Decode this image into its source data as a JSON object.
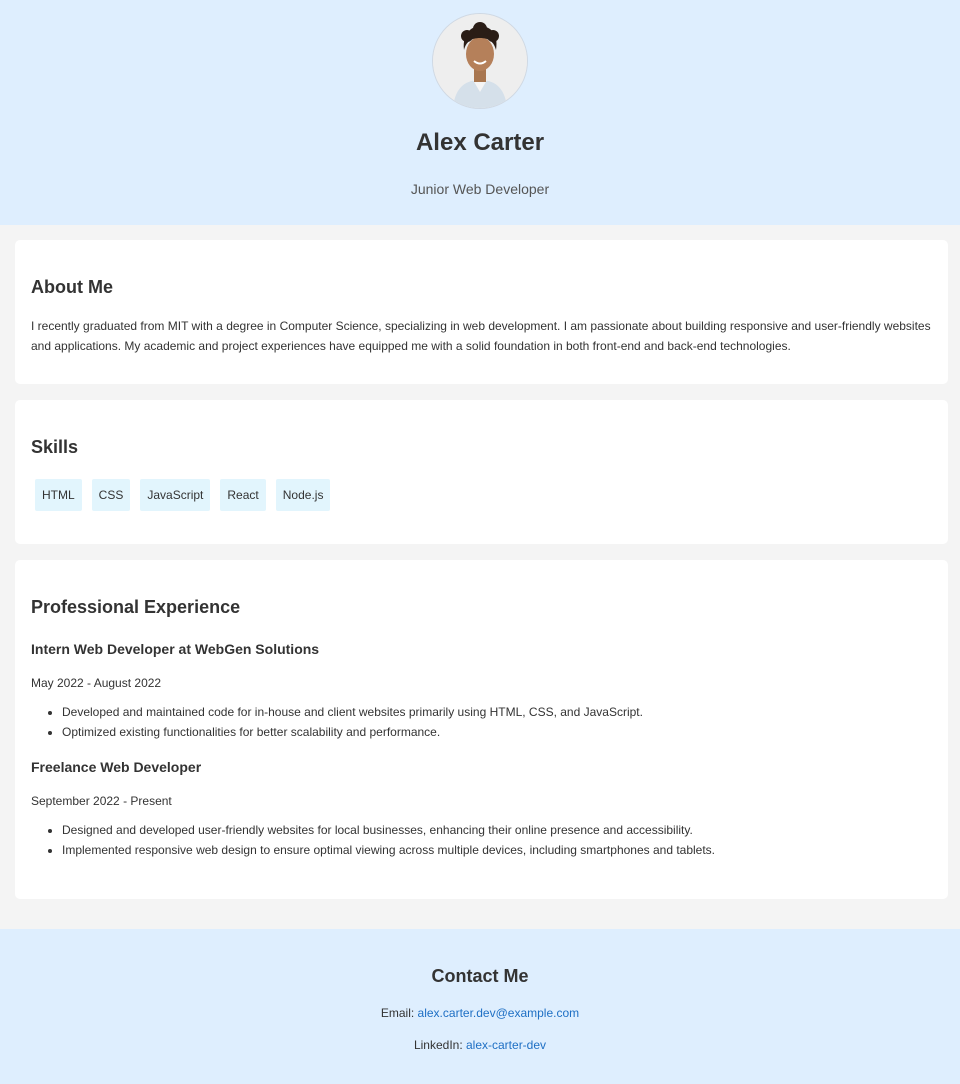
{
  "profile": {
    "name": "Alex Carter",
    "title": "Junior Web Developer"
  },
  "about": {
    "heading": "About Me",
    "text": "I recently graduated from MIT with a degree in Computer Science, specializing in web development. I am passionate about building responsive and user-friendly websites and applications. My academic and project experiences have equipped me with a solid foundation in both front-end and back-end technologies."
  },
  "skills": {
    "heading": "Skills",
    "items": [
      "HTML",
      "CSS",
      "JavaScript",
      "React",
      "Node.js"
    ]
  },
  "experience": {
    "heading": "Professional Experience",
    "jobs": [
      {
        "title": "Intern Web Developer at WebGen Solutions",
        "dates": "May 2022 - August 2022",
        "points": [
          "Developed and maintained code for in-house and client websites primarily using HTML, CSS, and JavaScript.",
          "Optimized existing functionalities for better scalability and performance."
        ]
      },
      {
        "title": "Freelance Web Developer",
        "dates": "September 2022 - Present",
        "points": [
          "Designed and developed user-friendly websites for local businesses, enhancing their online presence and accessibility.",
          "Implemented responsive web design to ensure optimal viewing across multiple devices, including smartphones and tablets."
        ]
      }
    ]
  },
  "contact": {
    "heading": "Contact Me",
    "email_label": "Email:",
    "email": "alex.carter.dev@example.com",
    "linkedin_label": "LinkedIn:",
    "linkedin": "alex-carter-dev"
  },
  "colors": {
    "header_bg": "#deeefe",
    "page_bg": "#f4f4f4",
    "skill_bg": "#e2f5fd",
    "link": "#1e6fc4"
  }
}
